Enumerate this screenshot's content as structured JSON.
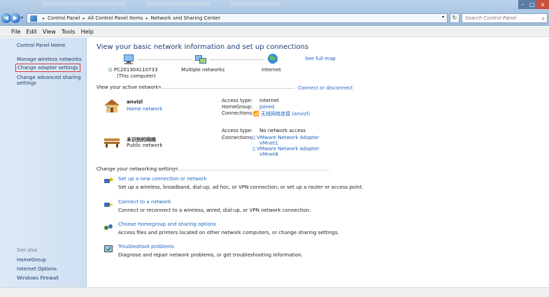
{
  "address_bar": {
    "crumbs": [
      "Control Panel",
      "All Control Panel Items",
      "Network and Sharing Center"
    ],
    "search_placeholder": "Search Control Panel"
  },
  "menu": [
    "File",
    "Edit",
    "View",
    "Tools",
    "Help"
  ],
  "sidebar": {
    "home": "Control Panel Home",
    "links": [
      "Manage wireless networks",
      "Change adapter settings",
      "Change advanced sharing settings"
    ],
    "see_also_title": "See also",
    "see_also": [
      "HomeGroup",
      "Internet Options",
      "Windows Firewall"
    ]
  },
  "main": {
    "heading": "View your basic network information and set up connections",
    "see_full_map": "See full map",
    "map": {
      "computer": "PC201304110733",
      "computer_sub": "(This computer)",
      "middle": "Multiple networks",
      "internet": "Internet"
    },
    "active_networks_title": "View your active networks",
    "connect_disconnect": "Connect or disconnect",
    "networks": [
      {
        "name": "anvizl",
        "type": "Home network",
        "access_type_label": "Access type:",
        "access_type": "Internet",
        "homegroup_label": "HomeGroup:",
        "homegroup": "Joined",
        "connections_label": "Connections:",
        "connection": "无线网络连接 (anvizl)"
      },
      {
        "name": "未识别的网络",
        "type": "Public network",
        "access_type_label": "Access type:",
        "access_type": "No network access",
        "connections_label": "Connections:",
        "connection1": "VMware Network Adapter",
        "connection1b": "VMnet1",
        "connection2": "VMware Network Adapter",
        "connection2b": "VMnet8"
      }
    ],
    "settings_title": "Change your networking settings",
    "tasks": [
      {
        "link": "Set up a new connection or network",
        "desc": "Set up a wireless, broadband, dial-up, ad hoc, or VPN connection; or set up a router or access point."
      },
      {
        "link": "Connect to a network",
        "desc": "Connect or reconnect to a wireless, wired, dial-up, or VPN network connection."
      },
      {
        "link": "Choose homegroup and sharing options",
        "desc": "Access files and printers located on other network computers, or change sharing settings."
      },
      {
        "link": "Troubleshoot problems",
        "desc": "Diagnose and repair network problems, or get troubleshooting information."
      }
    ]
  }
}
